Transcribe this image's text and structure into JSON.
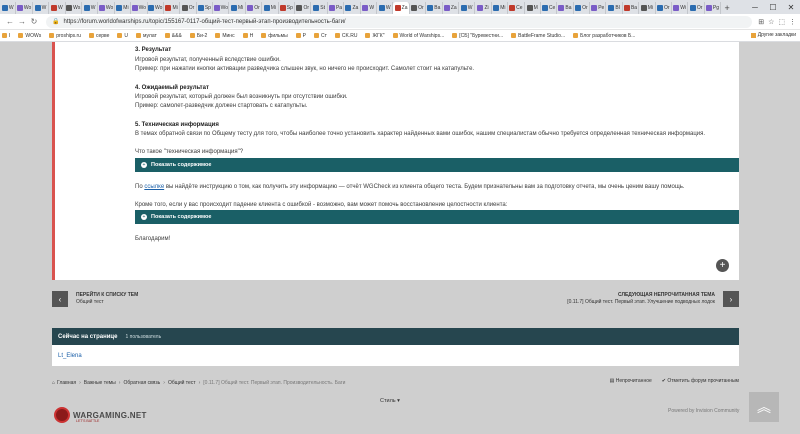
{
  "browser": {
    "tabs": [
      "W",
      "Wo",
      "W",
      "W",
      "Ws",
      "W",
      "Wo",
      "Mi",
      "Wo",
      "Wo",
      "Mi",
      "Or",
      "Sp",
      "Wo",
      "Mi",
      "Or",
      "Mi",
      "Sp",
      "Or",
      "St",
      "Pa",
      "Za",
      "W",
      "W",
      "Za",
      "Or",
      "Ba",
      "Za",
      "W",
      "Zi",
      "Mi",
      "Ce",
      "M",
      "Ce",
      "Ba",
      "Or",
      "Pe",
      "Bl",
      "Ba",
      "Mi",
      "Or",
      "Wi",
      "Or",
      "Pg"
    ],
    "url": "https://forum.worldofwarships.ru/topic/155167-0117-общий-тест-первый-этап-производительность-баги/",
    "bookmarks": [
      "I",
      "WOWs",
      "proships.ru",
      "серве",
      "U",
      "мулат",
      "&&&",
      "Би-2",
      "Минс",
      "H",
      "фильмы",
      "P",
      "Ст",
      "CK.RU",
      "ЖГК\"",
      "World of Warships...",
      "[СБ] \"Буревестни...",
      "BattleFrame Studio...",
      "Блог разработчиков Б..."
    ],
    "other_bookmarks": "Другие закладки"
  },
  "post": {
    "s3_title": "3. Результат",
    "s3_l1": "Игровой результат, полученный вследствие ошибки.",
    "s3_l2": "Пример: при нажатии кнопки активации разведчика слышен звук, но ничего не происходит. Самолет стоит на катапульте.",
    "s4_title": "4. Ожидаемый результат",
    "s4_l1": "Игровой результат, который должен был возникнуть при отсутствии ошибки.",
    "s4_l2": "Пример: самолет-разведчик должен стартовать с катапульты.",
    "s5_title": "5. Техническая информация",
    "s5_l1": "В темах обратной связи по Общему тесту для того, чтобы наиболее точно установить характер найденных вами ошибок, нашим специалистам обычно требуется определенная техническая информация.",
    "q": "Что такое \"техническая информация\"?",
    "spoiler1": "Показать содержимое",
    "inst_pre": "По ",
    "inst_link": "ссылке",
    "inst_post": " вы найдёте инструкцию о том, как получить эту информацию — отчёт WGCheck из клиента общего теста. Будем признательны вам за подготовку отчета, мы очень ценим вашу помощь.",
    "crash": "Кроме того, если у вас происходит падение клиента с ошибкой - возможно, вам может помочь восстановление целостности клиента:",
    "spoiler2": "Показать содержимое",
    "thanks": "Благодарим!"
  },
  "pager": {
    "prev_title": "ПЕРЕЙТИ К СПИСКУ ТЕМ",
    "prev_sub": "Общий тест",
    "next_title": "СЛЕДУЮЩАЯ НЕПРОЧИТАННАЯ ТЕМА",
    "next_sub": "[0.11.7] Общий тест. Первый этап. Улучшение подводных лодок"
  },
  "online": {
    "title": "Сейчас на странице",
    "count": "1 пользователь",
    "user": "Lt_Elena"
  },
  "breadcrumb": [
    "Главная",
    "Важные темы",
    "Обратная связь",
    "Общий тест",
    "[0.11.7] Общий тест. Первый этап. Производительность. Баги"
  ],
  "crumb_right": {
    "unread": "Непрочитанное",
    "mark": "Отметить форум прочитанным"
  },
  "footer": {
    "logo": "WARGAMING.NET",
    "logo_sub": "LET'S BATTLE",
    "style": "Стиль",
    "powered": "Powered by Invision Community"
  },
  "colors": {
    "accent": "#1a5f66",
    "header": "#26464f",
    "link": "#1a5fa8",
    "post_border": "#d9534f"
  }
}
